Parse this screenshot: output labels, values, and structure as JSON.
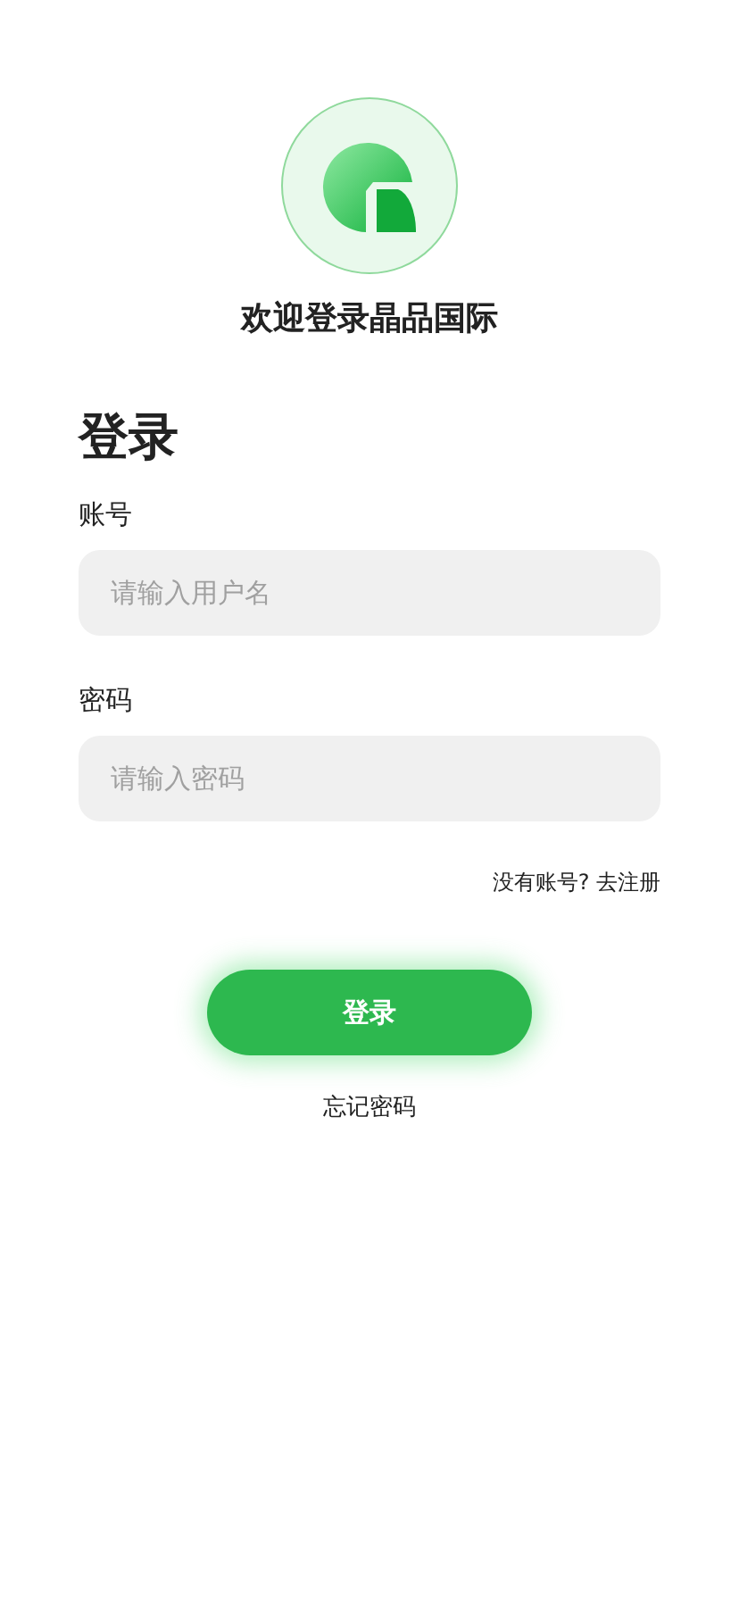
{
  "header": {
    "welcome": "欢迎登录晶品国际"
  },
  "form": {
    "title": "登录",
    "fields": [
      {
        "label": "账号",
        "placeholder": "请输入用户名"
      },
      {
        "label": "密码",
        "placeholder": "请输入密码"
      }
    ],
    "register_link": "没有账号? 去注册",
    "submit": "登录",
    "forgot_link": "忘记密码"
  }
}
